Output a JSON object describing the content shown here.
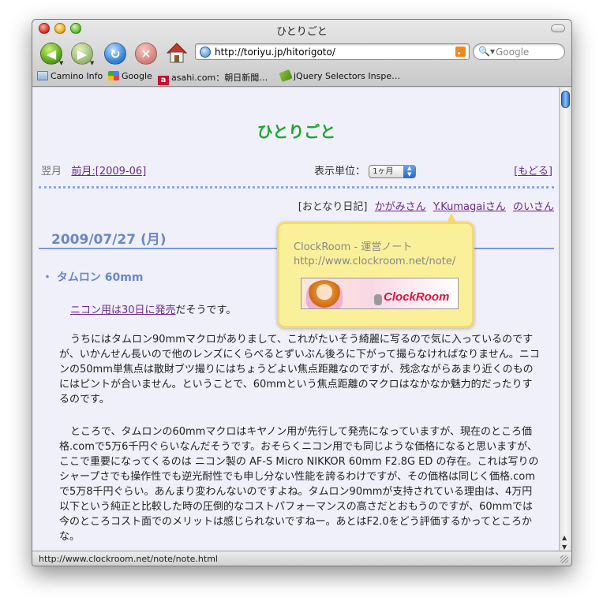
{
  "window": {
    "title": "ひとりごと",
    "url": "http://toriyu.jp/hitorigoto/",
    "search_placeholder": "Google",
    "status_text": "http://www.clockroom.net/note/note.html"
  },
  "bookmarks": [
    {
      "label": "Camino Info",
      "icon": "folder-icon"
    },
    {
      "label": "Google",
      "icon": "google-icon"
    },
    {
      "label": "asahi.com：朝日新聞…",
      "icon": "asahi-icon"
    },
    {
      "label": "jQuery Selectors Inspe…",
      "icon": "tag-icon"
    }
  ],
  "page": {
    "site_title": "ひとりごと",
    "next_label": "翌月",
    "prev_link": "前月:[2009-06]",
    "unit_label": "表示単位：",
    "unit_value": "1ヶ月",
    "back_link": "[もどる]",
    "neighbors_label": "[おとなり日記]",
    "neighbors": [
      "かがみさん",
      "Y.Kumagaiさん",
      "のいさん"
    ],
    "date": "2009/07/27 (月)",
    "entry_bullet": "・",
    "entry_title": "タムロン 60mm",
    "p1_link": "ニコン用は30日に発売",
    "p1_rest": "だそうです。",
    "p2": "うちにはタムロン90mmマクロがありまして、これがたいそう綺麗に写るので気に入っているのですが、いかんせん長いので他のレンズにくらべるとずいぶん後ろに下がって撮らなければなりません。ニコンの50mm単焦点は散財ブツ撮りにはちょうどよい焦点距離なのですが、残念ながらあまり近くのものにはピントが合いません。ということで、60mmという焦点距離のマクロはなかなか魅力的だったりするのです。",
    "p3": "ところで、タムロンの60mmマクロはキヤノン用が先行して発売になっていますが、現在のところ価格.comで5万6千円ぐらいなんだそうです。おそらくニコン用でも同じような価格になると思いますが、ここで重要になってくるのは ニコン製の AF-S Micro NIKKOR 60mm F2.8G ED の存在。これは写りのシャープさでも操作性でも逆光耐性でも申し分ない性能を誇るわけですが、その価格は同じく価格.comで5万8千円ぐらい。あんまり変わんないのですよね。タムロン90mmが支持されている理由は、4万円以下という純正と比較した時の圧倒的なコストパフォーマンスの高さだとおもうのですが、60mmでは今のところコスト面でのメリットは感じられないですねー。あとはF2.0をどう評価するかってところかな。"
  },
  "tooltip": {
    "title": "ClockRoom - 運営ノート",
    "url": "http://www.clockroom.net/note/",
    "banner_text": "ClockRoom"
  },
  "colors": {
    "site_title": "#1ea52f",
    "accent_blue": "#6a88c8",
    "link": "#6a2a8a",
    "page_bg": "#f0f0fa",
    "tooltip_bg": "#fbf09a"
  }
}
